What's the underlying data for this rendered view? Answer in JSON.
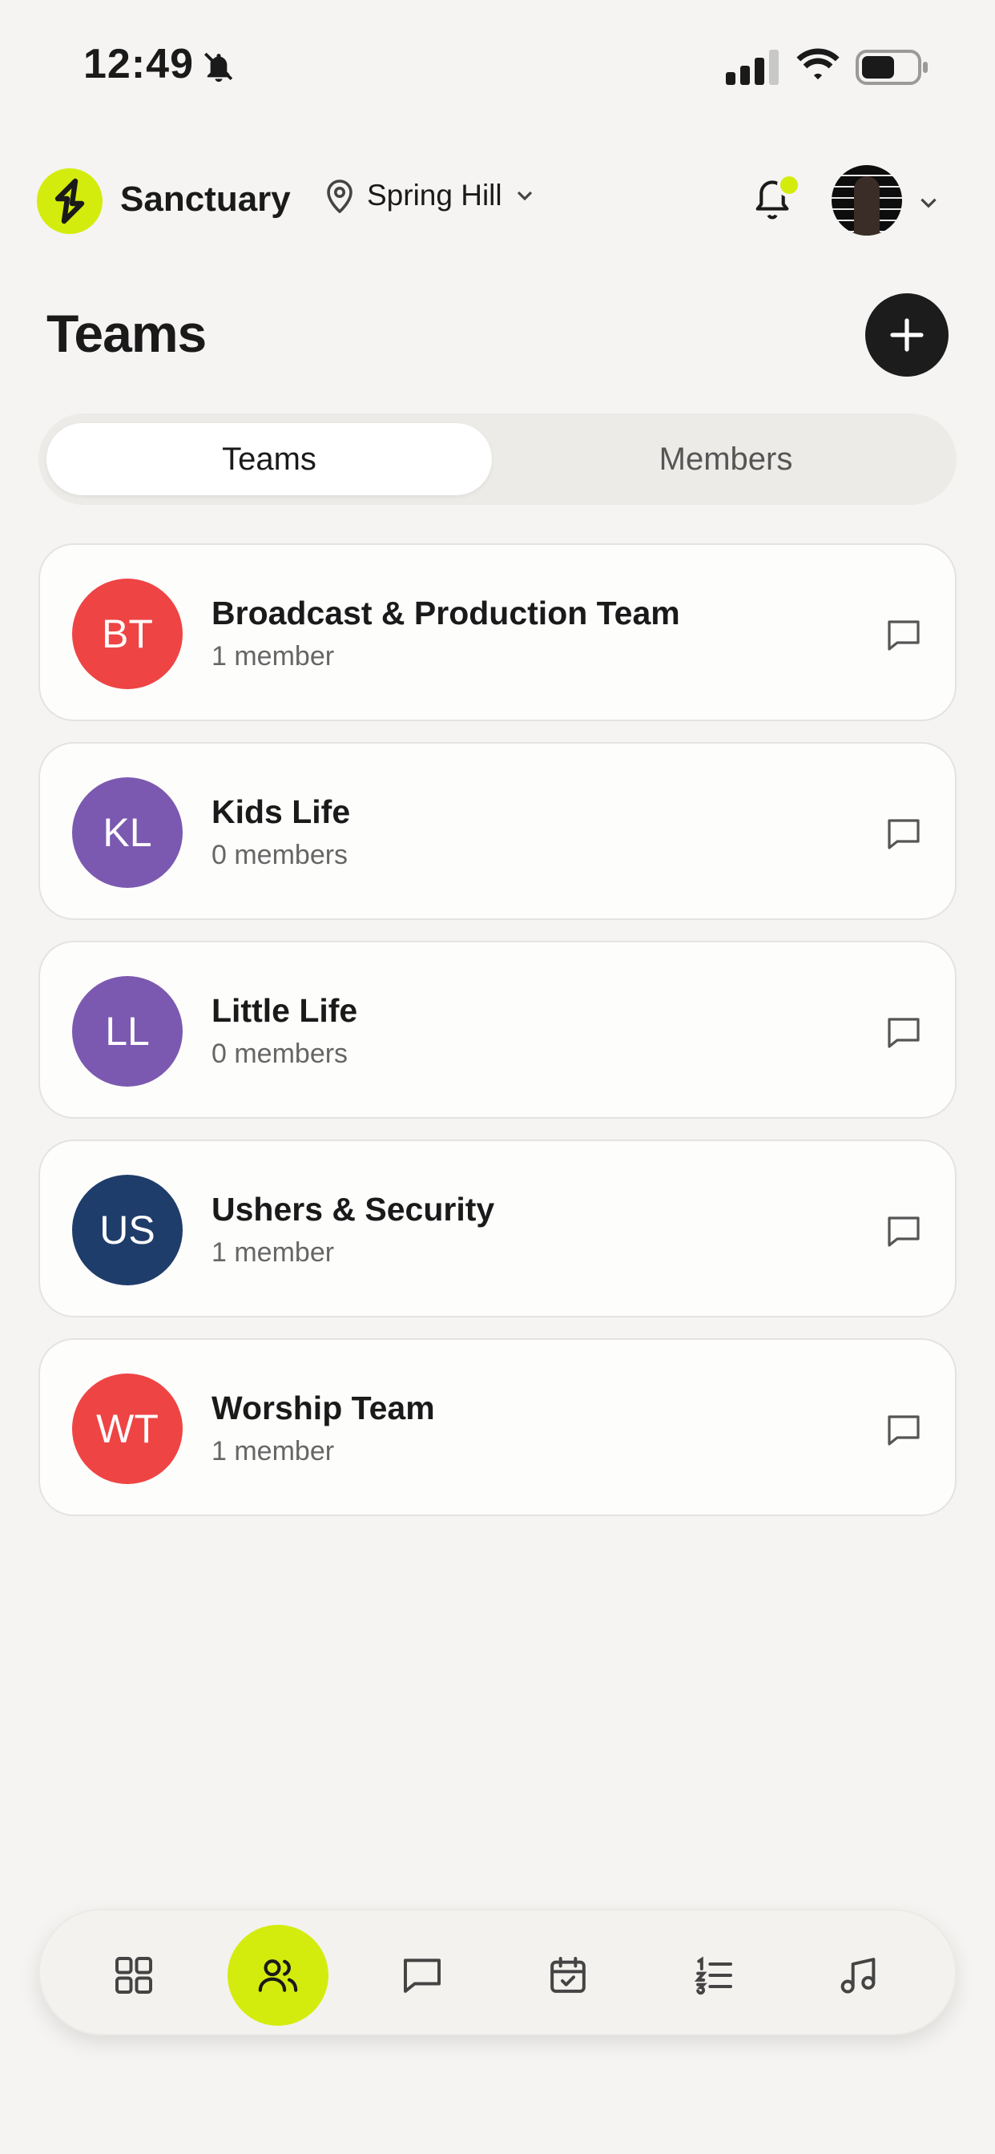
{
  "status_bar": {
    "time": "12:49"
  },
  "header": {
    "app_name": "Sanctuary",
    "location": "Spring Hill"
  },
  "page": {
    "title": "Teams"
  },
  "tabs": [
    {
      "label": "Teams",
      "active": true
    },
    {
      "label": "Members",
      "active": false
    }
  ],
  "teams": [
    {
      "initials": "BT",
      "name": "Broadcast & Production Team",
      "count": "1 member",
      "color": "#ef4444"
    },
    {
      "initials": "KL",
      "name": "Kids Life",
      "count": "0 members",
      "color": "#7c59b0"
    },
    {
      "initials": "LL",
      "name": "Little Life",
      "count": "0 members",
      "color": "#7c59b0"
    },
    {
      "initials": "US",
      "name": "Ushers & Security",
      "count": "1 member",
      "color": "#1f3d6b"
    },
    {
      "initials": "WT",
      "name": "Worship Team",
      "count": "1 member",
      "color": "#ef4444"
    }
  ],
  "bottom_nav": [
    {
      "icon": "grid-icon",
      "active": false
    },
    {
      "icon": "users-icon",
      "active": true
    },
    {
      "icon": "chat-icon",
      "active": false
    },
    {
      "icon": "calendar-check-icon",
      "active": false
    },
    {
      "icon": "ordered-list-icon",
      "active": false
    },
    {
      "icon": "music-note-icon",
      "active": false
    }
  ],
  "colors": {
    "accent": "#d4ec0d",
    "background": "#f5f4f2",
    "dark": "#1c1c1c"
  }
}
